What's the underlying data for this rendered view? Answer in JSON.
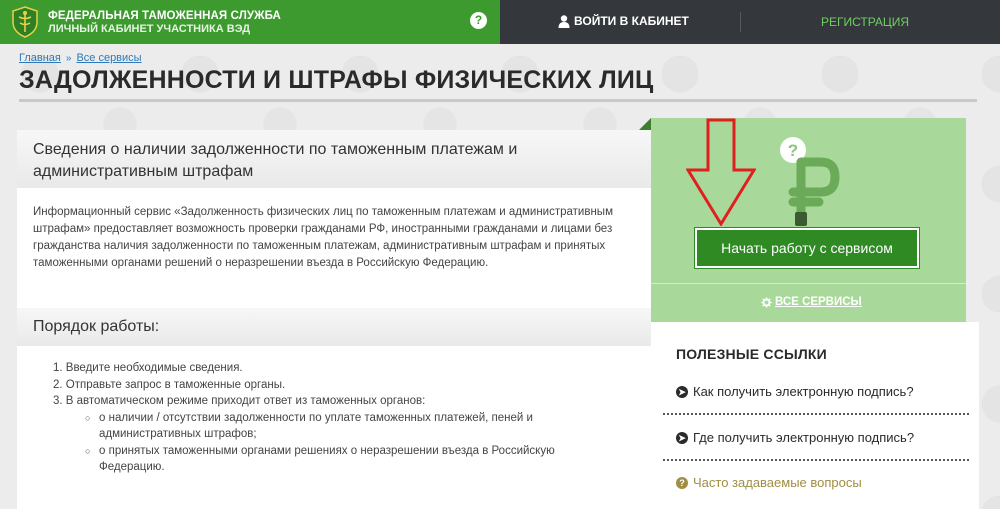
{
  "header": {
    "brand_line1": "ФЕДЕРАЛЬНАЯ ТАМОЖЕННАЯ СЛУЖБА",
    "brand_line2": "ЛИЧНЫЙ КАБИНЕТ УЧАСТНИКА ВЭД",
    "help_label": "?",
    "login_label": "ВОЙТИ В КАБИНЕТ",
    "register_label": "РЕГИСТРАЦИЯ"
  },
  "breadcrumb": {
    "items": [
      "Главная",
      "Все сервисы"
    ],
    "separator": "»"
  },
  "page_title": "ЗАДОЛЖЕННОСТИ И ШТРАФЫ ФИЗИЧЕСКИХ ЛИЦ",
  "main": {
    "section1_heading": "Сведения о наличии задолженности по таможенным платежам и административным штрафам",
    "intro_text": "Информационный сервис «Задолженность физических лиц по таможенным платежам и административным штрафам» предоставляет возможность проверки гражданами РФ, иностранными гражданами и лицами без гражданства наличия задолженности по таможенным платежам, административным штрафам и принятых таможенными органами решений о неразрешении въезда в Российскую Федерацию.",
    "section2_heading": "Порядок работы:",
    "steps": [
      "1. Введите необходимые сведения.",
      "2. Отправьте запрос в таможенные органы.",
      "3. В автоматическом режиме приходит ответ из таможенных органов:"
    ],
    "substeps": [
      "о наличии / отсутствии задолженности по уплате таможенных платежей, пеней и административных штрафов;",
      "о принятых таможенными органами решениях о неразрешении въезда в Российскую Федерацию."
    ]
  },
  "sidebar": {
    "start_button": "Начать работу с сервисом",
    "all_services": "ВСЕ СЕРВИСЫ",
    "links_title": "ПОЛЕЗНЫЕ ССЫЛКИ",
    "links": [
      "Как получить электронную подпись?",
      "Где получить электронную подпись?",
      "Часто задаваемые вопросы"
    ]
  },
  "colors": {
    "header_green": "#3c9a2f",
    "header_dark": "#34383c",
    "panel_green": "#a9d99a",
    "button_green": "#2f8a24",
    "arrow_red": "#e02020"
  }
}
